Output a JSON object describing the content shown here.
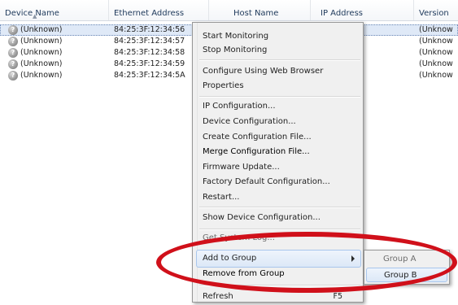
{
  "table": {
    "columns": [
      "Device Name",
      "Ethernet Address",
      "Host Name",
      "IP Address",
      "Version"
    ],
    "rows": [
      {
        "device_name": "(Unknown)",
        "ethernet": "84:25:3F:12:34:56",
        "version": "(Unknow"
      },
      {
        "device_name": "(Unknown)",
        "ethernet": "84:25:3F:12:34:57",
        "version": "(Unknow"
      },
      {
        "device_name": "(Unknown)",
        "ethernet": "84:25:3F:12:34:58",
        "version": "(Unknow"
      },
      {
        "device_name": "(Unknown)",
        "ethernet": "84:25:3F:12:34:59",
        "version": "(Unknow"
      },
      {
        "device_name": "(Unknown)",
        "ethernet": "84:25:3F:12:34:5A",
        "version": "(Unknow"
      }
    ]
  },
  "context_menu": {
    "items": [
      {
        "label": "Start Monitoring"
      },
      {
        "label": "Stop Monitoring"
      },
      {
        "label": "Configure Using Web Browser"
      },
      {
        "label": "Properties"
      },
      {
        "label": "IP Configuration..."
      },
      {
        "label": "Device Configuration..."
      },
      {
        "label": "Create Configuration File..."
      },
      {
        "label": "Merge Configuration File..."
      },
      {
        "label": "Firmware Update..."
      },
      {
        "label": "Factory Default Configuration..."
      },
      {
        "label": "Restart..."
      },
      {
        "label": "Show Device Configuration..."
      },
      {
        "label": "Get System Log..."
      },
      {
        "label": "Add to Group"
      },
      {
        "label": "Remove from Group"
      },
      {
        "label": "Refresh",
        "shortcut": "F5"
      }
    ]
  },
  "submenu": {
    "items": [
      {
        "label": "Group A"
      },
      {
        "label": "Group B"
      }
    ]
  },
  "colors": {
    "highlight_circle": "#d0101a",
    "selection": "#dfe9f7",
    "menu_background": "#f0f0f0"
  }
}
